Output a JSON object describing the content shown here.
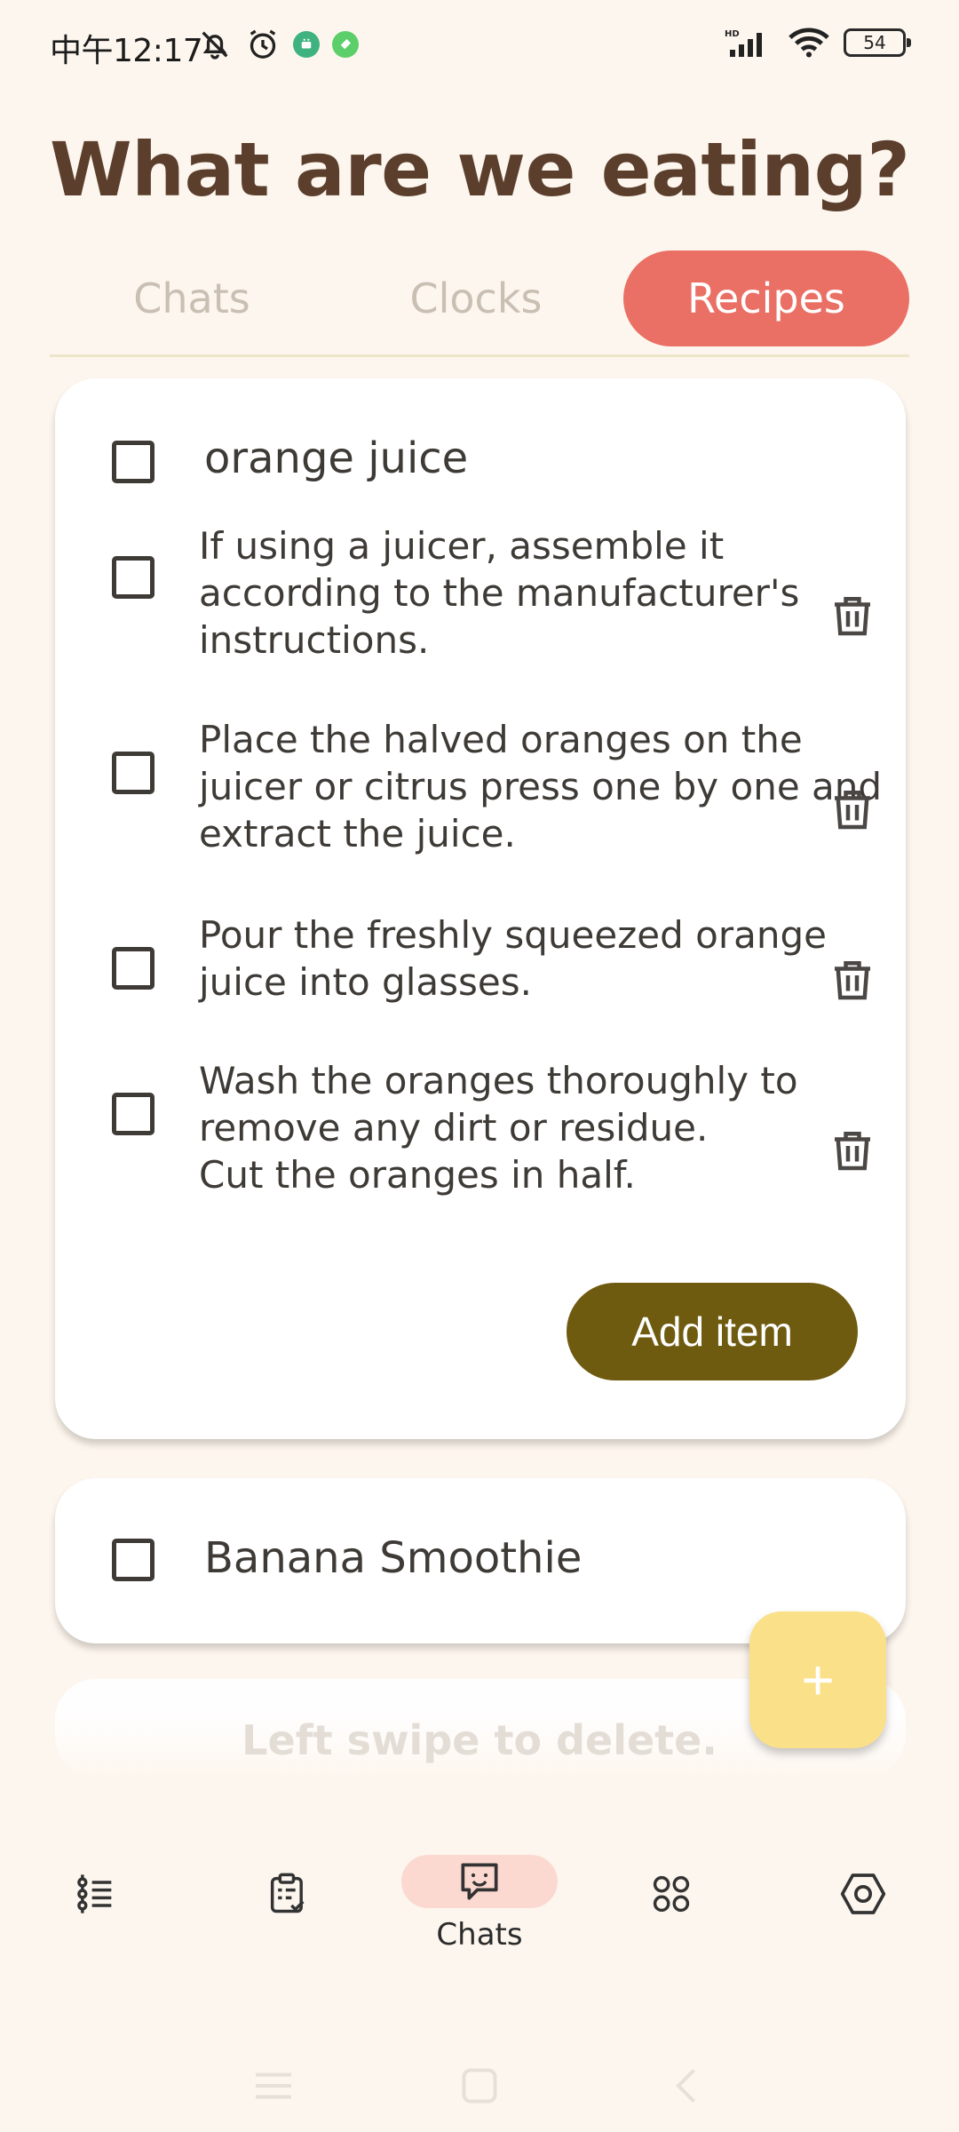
{
  "status_bar": {
    "time": "中午12:17",
    "battery": "54",
    "network": "HD"
  },
  "page_title": "What are we eating?",
  "tabs": [
    {
      "label": "Chats",
      "active": false
    },
    {
      "label": "Clocks",
      "active": false
    },
    {
      "label": "Recipes",
      "active": true
    }
  ],
  "recipes": [
    {
      "title": "orange juice",
      "items": [
        {
          "text": "If using a juicer, assemble it according to the manufacturer's instructions."
        },
        {
          "text": "Place the halved oranges on the juicer or citrus press one by one and extract the juice."
        },
        {
          "text": "Pour the freshly squeezed orange juice into glasses."
        },
        {
          "text": "Wash the oranges thoroughly to remove any dirt or residue.\nCut the oranges in half."
        }
      ],
      "add_item_label": "Add item"
    },
    {
      "title": "Banana Smoothie",
      "items": []
    }
  ],
  "hint": "Left swipe to delete.",
  "fab_label": "+",
  "bottom_nav": {
    "active_label": "Chats"
  },
  "colors": {
    "accent_tab": "#ea6f64",
    "add_button": "#6e5b0f",
    "fab": "#fbe08a",
    "title": "#5b3f2c",
    "nav_active": "#fcd9d0"
  }
}
